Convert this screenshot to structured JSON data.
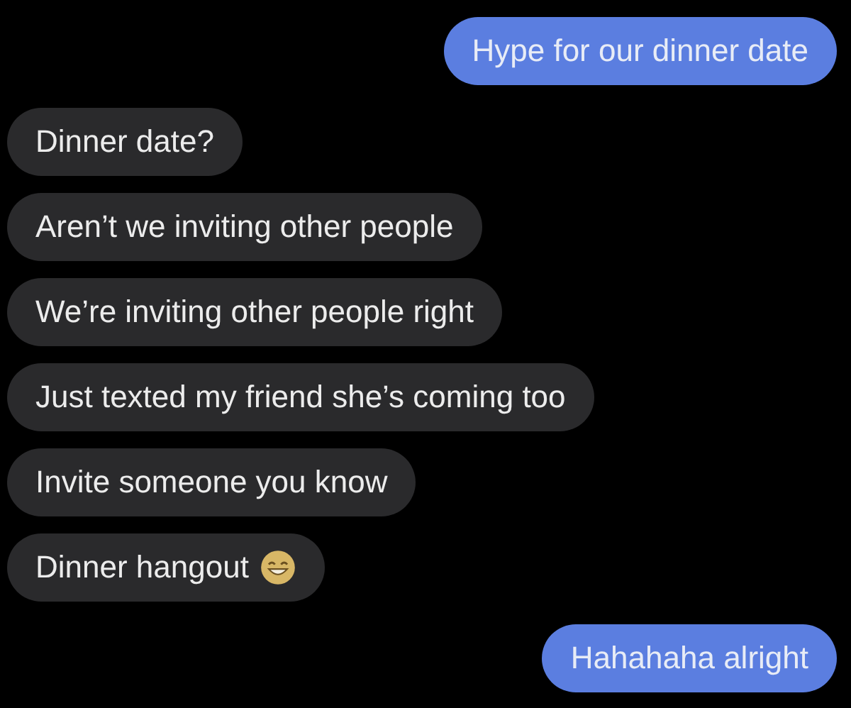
{
  "messages": [
    {
      "kind": "sent",
      "text": "Hype for our dinner date"
    },
    {
      "kind": "received",
      "text": "Dinner date?"
    },
    {
      "kind": "received",
      "text": "Aren’t we inviting other people"
    },
    {
      "kind": "received",
      "text": "We’re inviting other people right"
    },
    {
      "kind": "received",
      "text": "Just texted my friend she’s coming too"
    },
    {
      "kind": "received",
      "text": "Invite someone you know"
    },
    {
      "kind": "received",
      "text": "Dinner hangout",
      "emoji": true
    },
    {
      "kind": "sent",
      "text": "Hahahaha alright"
    }
  ]
}
